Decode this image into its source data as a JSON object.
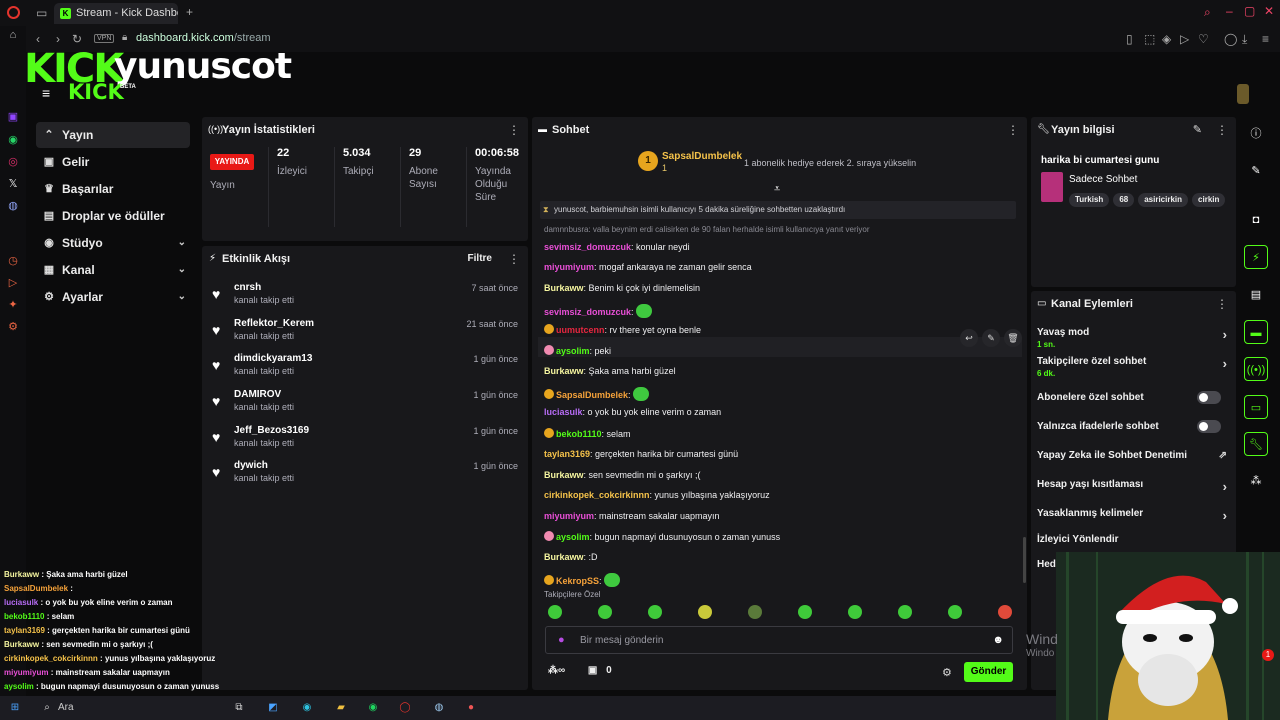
{
  "browser": {
    "tab_title": "Stream - Kick Dashboard",
    "vpn_label": "VPN",
    "url_domain": "dashboard.kick.com",
    "url_path": "/stream"
  },
  "overlay_logo": {
    "kick": "KICK",
    "channel": "yunuscot",
    "kick_small": "KICK",
    "beta": "BETA"
  },
  "sidebar": {
    "items": [
      {
        "label": "Yayın",
        "icon": "broadcast-icon"
      },
      {
        "label": "Gelir",
        "icon": "revenue-icon"
      },
      {
        "label": "Başarılar",
        "icon": "trophy-icon"
      },
      {
        "label": "Droplar ve ödüller",
        "icon": "gift-icon"
      },
      {
        "label": "Stüdyo",
        "icon": "studio-icon"
      },
      {
        "label": "Kanal",
        "icon": "channel-icon"
      },
      {
        "label": "Ayarlar",
        "icon": "gear-icon"
      }
    ]
  },
  "stats": {
    "title": "Yayın İstatistikleri",
    "live_badge": "YAYINDA",
    "live_label": "Yayın",
    "viewers": "22",
    "viewers_label": "İzleyici",
    "followers": "5.034",
    "followers_label": "Takipçi",
    "subs": "29",
    "subs_label": "Abone Sayısı",
    "uptime": "00:06:58",
    "uptime_label": "Yayında Olduğu Süre"
  },
  "activity": {
    "title": "Etkinlik Akışı",
    "filter": "Filtre",
    "items": [
      {
        "name": "cnrsh",
        "sub": "kanalı takip etti",
        "time": "7 saat önce"
      },
      {
        "name": "Reflektor_Kerem",
        "sub": "kanalı takip etti",
        "time": "21 saat önce"
      },
      {
        "name": "dimdickyaram13",
        "sub": "kanalı takip etti",
        "time": "1 gün önce"
      },
      {
        "name": "DAMIROV",
        "sub": "kanalı takip etti",
        "time": "1 gün önce"
      },
      {
        "name": "Jeff_Bezos3169",
        "sub": "kanalı takip etti",
        "time": "1 gün önce"
      },
      {
        "name": "dywich",
        "sub": "kanalı takip etti",
        "time": "1 gün önce"
      }
    ]
  },
  "chat": {
    "title": "Sohbet",
    "pinned": {
      "name": "SapsalDumbelek",
      "sub_count": "1",
      "badge": "1",
      "message": "1 abonelik hediye ederek 2. sıraya yükselin"
    },
    "system": "yunuscot, barbiemuhsin isimli kullanıcıyı 5 dakika süreliğine sohbetten uzaklaştırdı",
    "reply": "damnnbusra: valla beynim erdi calisirken de 90 falan herhalde isimli kullanıcıya yanıt veriyor",
    "messages": [
      {
        "user": "sevimsiz_domuzcuk",
        "color": "#e84fd6",
        "text": ": konular neydi"
      },
      {
        "user": "miyumiyum",
        "color": "#e84fd6",
        "text": ": mogaf ankaraya ne zaman gelir senca"
      },
      {
        "user": "Burkaww",
        "color": "#f5f5a0",
        "text": ": Benim ki çok iyi dinlemelisin"
      },
      {
        "user": "sevimsiz_domuzcuk",
        "color": "#e84fd6",
        "text": ":"
      },
      {
        "user": "uumutcenn",
        "color": "#e5263f",
        "text": ": rv there yet oyna benle"
      },
      {
        "user": "aysolim",
        "color": "#53fc18",
        "text": ": peki"
      },
      {
        "user": "Burkaww",
        "color": "#f5f5a0",
        "text": ": Şaka ama harbi güzel"
      },
      {
        "user": "SapsalDumbelek",
        "color": "#f5a23a",
        "text": ":"
      },
      {
        "user": "luciasulk",
        "color": "#b76cf5",
        "text": ": o yok bu yok eline verim o zaman"
      },
      {
        "user": "bekob1110",
        "color": "#53fc18",
        "text": ": selam"
      },
      {
        "user": "taylan3169",
        "color": "#f5c24a",
        "text": ": gerçekten harika bir cumartesi günü"
      },
      {
        "user": "Burkaww",
        "color": "#f5f5a0",
        "text": ": sen sevmedin mi o şarkıyı ;("
      },
      {
        "user": "cirkinkopek_cokcirkinnn",
        "color": "#f5c24a",
        "text": ": yunus yılbaşına yaklaşıyoruz"
      },
      {
        "user": "miyumiyum",
        "color": "#e84fd6",
        "text": ": mainstream sakalar uapmayın"
      },
      {
        "user": "aysolim",
        "color": "#53fc18",
        "text": ": bugun napmayi dusunuyosun o zaman yunuss"
      },
      {
        "user": "Burkaww",
        "color": "#f5f5a0",
        "text": ": :D"
      },
      {
        "user": "KekropSS",
        "color": "#f5a23a",
        "text": ":"
      }
    ],
    "subs_only_label": "Takipçilere Özel",
    "input_placeholder": "Bir mesaj gönderin",
    "points": "0",
    "send": "Gönder"
  },
  "info": {
    "title": "Yayın bilgisi",
    "stream_title": "harika bi cumartesi gunu",
    "category": "Sadece Sohbet",
    "tags": [
      "Turkish",
      "68",
      "asiricirkin",
      "cirkin"
    ]
  },
  "channel_actions": {
    "title": "Kanal Eylemleri",
    "items": [
      {
        "label": "Yavaş mod",
        "sub": "1 sn.",
        "kind": "chevron"
      },
      {
        "label": "Takipçilere özel sohbet",
        "sub": "6 dk.",
        "kind": "chevron"
      },
      {
        "label": "Abonelere özel sohbet",
        "sub": "",
        "kind": "toggle"
      },
      {
        "label": "Yalnızca ifadelerle sohbet",
        "sub": "",
        "kind": "toggle"
      },
      {
        "label": "Yapay Zeka ile Sohbet Denetimi",
        "sub": "",
        "kind": "external"
      },
      {
        "label": "Hesap yaşı kısıtlaması",
        "sub": "",
        "kind": "chevron"
      },
      {
        "label": "Yasaklanmış kelimeler",
        "sub": "",
        "kind": "chevron"
      },
      {
        "label": "İzleyici Yönlendir",
        "sub": "",
        "kind": "none"
      },
      {
        "label": "Hed",
        "sub": "",
        "kind": "none"
      }
    ]
  },
  "overlay_chat": [
    {
      "user": "Burkaww",
      "text": " : Şaka ama harbi güzel",
      "color": "#f5f5a0"
    },
    {
      "user": "SapsalDumbelek",
      "text": " :",
      "color": "#f5a23a"
    },
    {
      "user": "luciasulk",
      "text": " : o yok bu yok eline verim o zaman",
      "color": "#b76cf5"
    },
    {
      "user": "bekob1110",
      "text": " : selam",
      "color": "#53fc18"
    },
    {
      "user": "taylan3169",
      "text": " : gerçekten harika bir cumartesi günü",
      "color": "#f5c24a"
    },
    {
      "user": "Burkaww",
      "text": " : sen sevmedin mi o şarkıyı ;(",
      "color": "#f5f5a0"
    },
    {
      "user": "cirkinkopek_cokcirkinnn",
      "text": " : yunus yılbaşına yaklaşıyoruz",
      "color": "#f5c24a"
    },
    {
      "user": "miyumiyum",
      "text": " : mainstream sakalar uapmayın",
      "color": "#e84fd6"
    },
    {
      "user": "aysolim",
      "text": " : bugun napmayi dusunuyosun o zaman yunuss",
      "color": "#53fc18"
    }
  ],
  "taskbar": {
    "search": "Ara"
  },
  "watermark": {
    "line1": "Wind",
    "line2": "Windo"
  },
  "cam_badge": "1",
  "colors": {
    "kick_green": "#53fc18",
    "live_red": "#e91916",
    "panel_bg": "#18181b",
    "page_bg": "#0b0b0c"
  }
}
